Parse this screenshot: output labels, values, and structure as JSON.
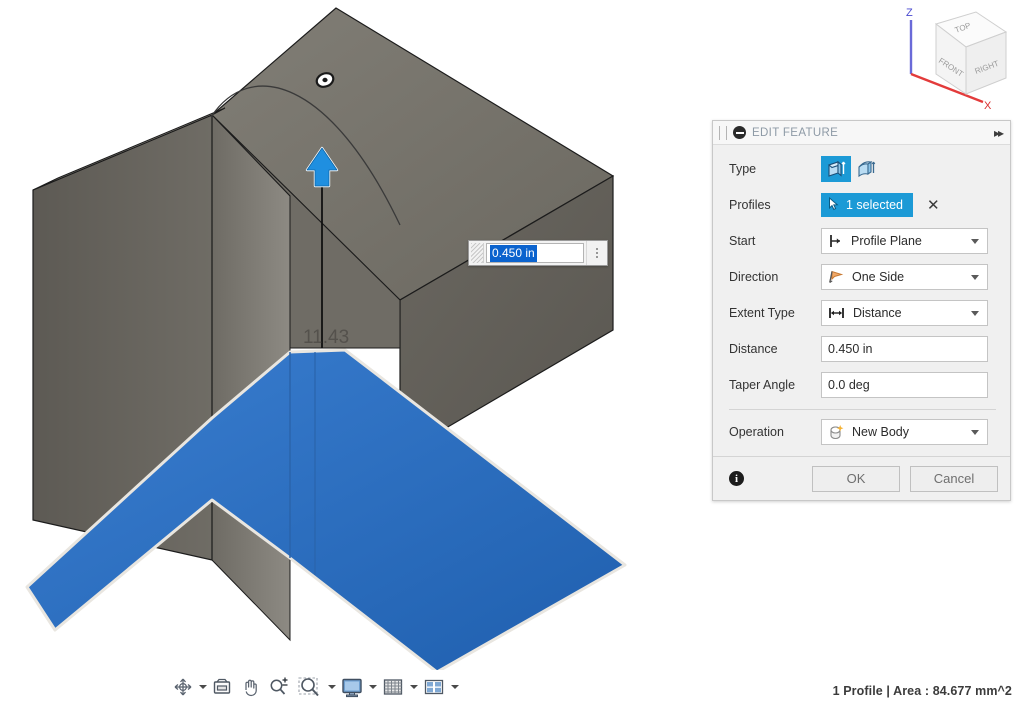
{
  "viewport": {
    "dimension_input": {
      "value": "0.450 in",
      "menu_icon": "kebab-menu-icon",
      "grip_icon": "drag-grip-icon"
    },
    "manipulator_arrow": "extrude-arrow-up-icon",
    "sketch_dimension_label": "11.43",
    "point_marker": "sketch-point-icon",
    "colors": {
      "body_gray_light": "#7b786f",
      "body_gray_mid": "#6e6b63",
      "body_gray_dark": "#55524c",
      "profile_blue": "#2a6ebb",
      "profile_blue_light": "#3a7fd0",
      "highlight_blue": "#1c9ad6",
      "edge": "#1a1a1a"
    }
  },
  "viewcube": {
    "faces": {
      "top": "TOP",
      "front": "FRONT",
      "right": "RIGHT"
    },
    "axes": {
      "z": "Z",
      "x": "X"
    },
    "axis_colors": {
      "z": "#5a5ad0",
      "x": "#e03030"
    }
  },
  "navbar": {
    "items": [
      {
        "name": "orbit-icon",
        "label": "Orbit",
        "has_caret": true
      },
      {
        "name": "look-at-icon",
        "label": "Look At",
        "has_caret": false
      },
      {
        "name": "pan-hand-icon",
        "label": "Pan",
        "has_caret": false
      },
      {
        "name": "zoom-in-out-icon",
        "label": "Zoom",
        "has_caret": false
      },
      {
        "name": "zoom-window-icon",
        "label": "Zoom Window",
        "has_caret": true
      },
      {
        "name": "display-settings-icon",
        "label": "Display Settings",
        "has_caret": true
      },
      {
        "name": "grid-snaps-icon",
        "label": "Grid and Snaps",
        "has_caret": true
      },
      {
        "name": "viewports-icon",
        "label": "Viewports",
        "has_caret": true
      }
    ]
  },
  "statusbar": {
    "text": "1 Profile | Area : 84.677 mm^2"
  },
  "panel": {
    "title": "EDIT FEATURE",
    "collapse_icon": "collapse-minus-icon",
    "grip_icon": "panel-drag-grip-icon",
    "expand_icon": "expand-right-icon",
    "rows": {
      "type": {
        "label": "Type",
        "options": [
          {
            "name": "extrude-profile-icon",
            "selected": true
          },
          {
            "name": "extrude-taper-icon",
            "selected": false
          }
        ]
      },
      "profiles": {
        "label": "Profiles",
        "value": "1 selected",
        "cursor_icon": "select-cursor-icon",
        "clear_icon": "clear-x-icon",
        "clear_label": "✕"
      },
      "start": {
        "label": "Start",
        "value": "Profile Plane",
        "icon": "profile-plane-icon"
      },
      "direction": {
        "label": "Direction",
        "value": "One Side",
        "icon": "one-side-flag-icon"
      },
      "extent_type": {
        "label": "Extent Type",
        "value": "Distance",
        "icon": "distance-arrows-icon"
      },
      "distance": {
        "label": "Distance",
        "value": "0.450 in"
      },
      "taper_angle": {
        "label": "Taper Angle",
        "value": "0.0 deg"
      },
      "operation": {
        "label": "Operation",
        "value": "New Body",
        "icon": "new-body-icon"
      }
    },
    "footer": {
      "info_icon": "info-icon",
      "info_label": "i",
      "ok_label": "OK",
      "cancel_label": "Cancel"
    },
    "colors": {
      "accent": "#1c9ad6",
      "panel_bg": "#f0f0f0",
      "title_text": "#8e9aa6"
    }
  }
}
